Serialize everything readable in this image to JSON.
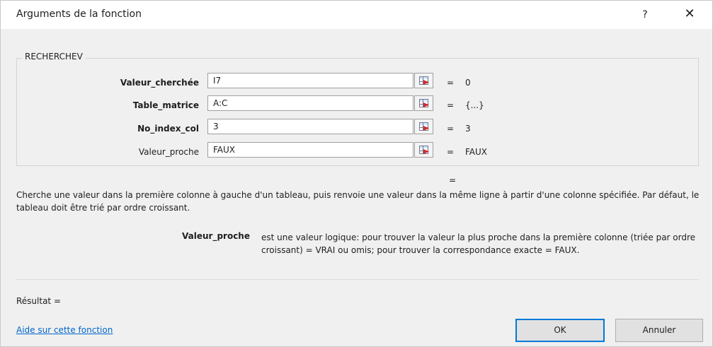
{
  "dialog": {
    "title": "Arguments de la fonction",
    "help_button": "?",
    "close_button": "✕"
  },
  "function_name": "RECHERCHEV",
  "arguments": [
    {
      "label": "Valeur_cherchée",
      "value": "I7",
      "result": "0",
      "bold": true
    },
    {
      "label": "Table_matrice",
      "value": "A:C",
      "result": "{...}",
      "bold": true
    },
    {
      "label": "No_index_col",
      "value": "3",
      "result": "3",
      "bold": true
    },
    {
      "label": "Valeur_proche",
      "value": "FAUX",
      "result": "FAUX",
      "bold": false
    }
  ],
  "equals_sign": "=",
  "formula_result_sign": "=",
  "description": "Cherche une valeur dans la première colonne à gauche d'un tableau, puis renvoie une valeur dans la même ligne à partir d'une colonne spécifiée. Par défaut, le tableau doit être trié par ordre croissant.",
  "parameter_help": {
    "name": "Valeur_proche",
    "text": "est une valeur logique: pour trouver la valeur la plus proche dans la première colonne (triée par ordre croissant) = VRAI ou omis; pour trouver la correspondance exacte = FAUX."
  },
  "result_label": "Résultat =",
  "help_link": "Aide sur cette fonction",
  "buttons": {
    "ok": "OK",
    "cancel": "Annuler"
  },
  "icons": {
    "ref_button": "range-select-icon"
  }
}
